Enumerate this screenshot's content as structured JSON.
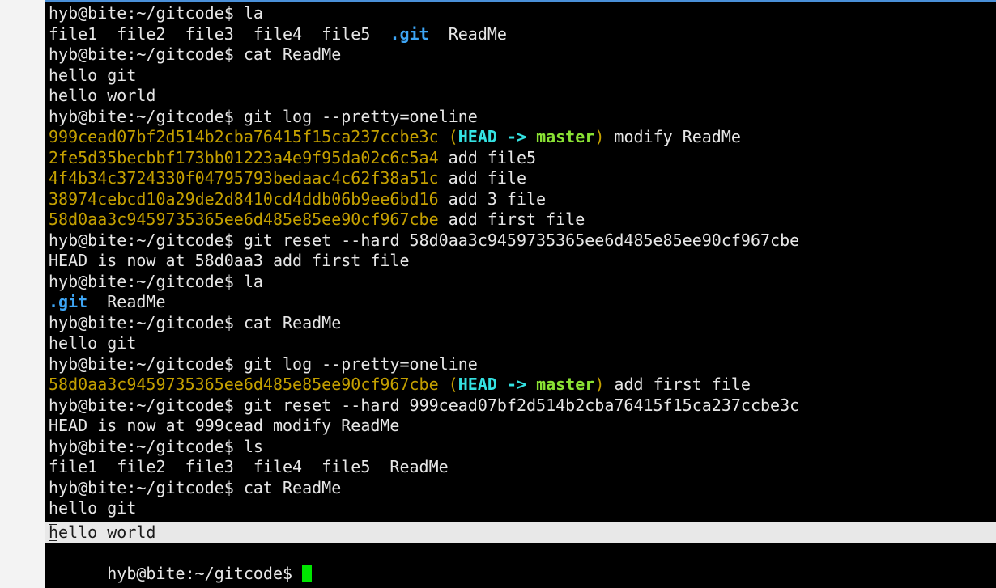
{
  "terminal": {
    "prompt": "hyb@bite:~/gitcode$ ",
    "lines": [
      {
        "type": "cmd",
        "text": "la"
      },
      {
        "type": "plain",
        "segments": [
          {
            "t": "file1  file2  file3  file4  file5  ",
            "c": ""
          },
          {
            "t": ".git",
            "c": "dir"
          },
          {
            "t": "  ReadMe",
            "c": ""
          }
        ]
      },
      {
        "type": "cmd",
        "text": "cat ReadMe"
      },
      {
        "type": "plain",
        "segments": [
          {
            "t": "hello git",
            "c": ""
          }
        ]
      },
      {
        "type": "plain",
        "segments": [
          {
            "t": "hello world",
            "c": ""
          }
        ]
      },
      {
        "type": "cmd",
        "text": "git log --pretty=oneline"
      },
      {
        "type": "plain",
        "segments": [
          {
            "t": "999cead07bf2d514b2cba76415f15ca237ccbe3c",
            "c": "hash"
          },
          {
            "t": " (",
            "c": "paren"
          },
          {
            "t": "HEAD -> ",
            "c": "cyan"
          },
          {
            "t": "master",
            "c": "green"
          },
          {
            "t": ")",
            "c": "paren"
          },
          {
            "t": " modify ReadMe",
            "c": ""
          }
        ]
      },
      {
        "type": "plain",
        "segments": [
          {
            "t": "2fe5d35becbbf173bb01223a4e9f95da02c6c5a4",
            "c": "hash"
          },
          {
            "t": " add file5",
            "c": ""
          }
        ]
      },
      {
        "type": "plain",
        "segments": [
          {
            "t": "4f4b34c3724330f04795793bedaac4c62f38a51c",
            "c": "hash"
          },
          {
            "t": " add file",
            "c": ""
          }
        ]
      },
      {
        "type": "plain",
        "segments": [
          {
            "t": "38974cebcd10a29de2d8410cd4ddb06b9ee6bd16",
            "c": "hash"
          },
          {
            "t": " add 3 file",
            "c": ""
          }
        ]
      },
      {
        "type": "plain",
        "segments": [
          {
            "t": "58d0aa3c9459735365ee6d485e85ee90cf967cbe",
            "c": "hash"
          },
          {
            "t": " add first file",
            "c": ""
          }
        ]
      },
      {
        "type": "cmd",
        "text": "git reset --hard 58d0aa3c9459735365ee6d485e85ee90cf967cbe"
      },
      {
        "type": "plain",
        "segments": [
          {
            "t": "HEAD is now at 58d0aa3 add first file",
            "c": ""
          }
        ]
      },
      {
        "type": "cmd",
        "text": "la"
      },
      {
        "type": "plain",
        "segments": [
          {
            "t": ".git",
            "c": "dir"
          },
          {
            "t": "  ReadMe",
            "c": ""
          }
        ]
      },
      {
        "type": "cmd",
        "text": "cat ReadMe"
      },
      {
        "type": "plain",
        "segments": [
          {
            "t": "hello git",
            "c": ""
          }
        ]
      },
      {
        "type": "cmd",
        "text": "git log --pretty=oneline"
      },
      {
        "type": "plain",
        "segments": [
          {
            "t": "58d0aa3c9459735365ee6d485e85ee90cf967cbe",
            "c": "hash"
          },
          {
            "t": " (",
            "c": "paren"
          },
          {
            "t": "HEAD -> ",
            "c": "cyan"
          },
          {
            "t": "master",
            "c": "green"
          },
          {
            "t": ")",
            "c": "paren"
          },
          {
            "t": " add first file",
            "c": ""
          }
        ]
      },
      {
        "type": "cmd",
        "text": "git reset --hard 999cead07bf2d514b2cba76415f15ca237ccbe3c"
      },
      {
        "type": "plain",
        "segments": [
          {
            "t": "HEAD is now at 999cead modify ReadMe",
            "c": ""
          }
        ]
      },
      {
        "type": "cmd",
        "text": "ls"
      },
      {
        "type": "plain",
        "segments": [
          {
            "t": "file1  file2  file3  file4  file5  ReadMe",
            "c": ""
          }
        ]
      },
      {
        "type": "cmd",
        "text": "cat ReadMe"
      },
      {
        "type": "plain",
        "segments": [
          {
            "t": "hello git",
            "c": ""
          }
        ]
      }
    ],
    "highlighted_line": "hello world",
    "last_prompt_input": ""
  },
  "colors": {
    "background": "#000000",
    "text": "#e6e6e6",
    "hash": "#c4a000",
    "directory": "#3da5f5",
    "head": "#34e2e2",
    "branch": "#8ae234",
    "cursor": "#00e600",
    "selection": "#e8e8e8"
  }
}
